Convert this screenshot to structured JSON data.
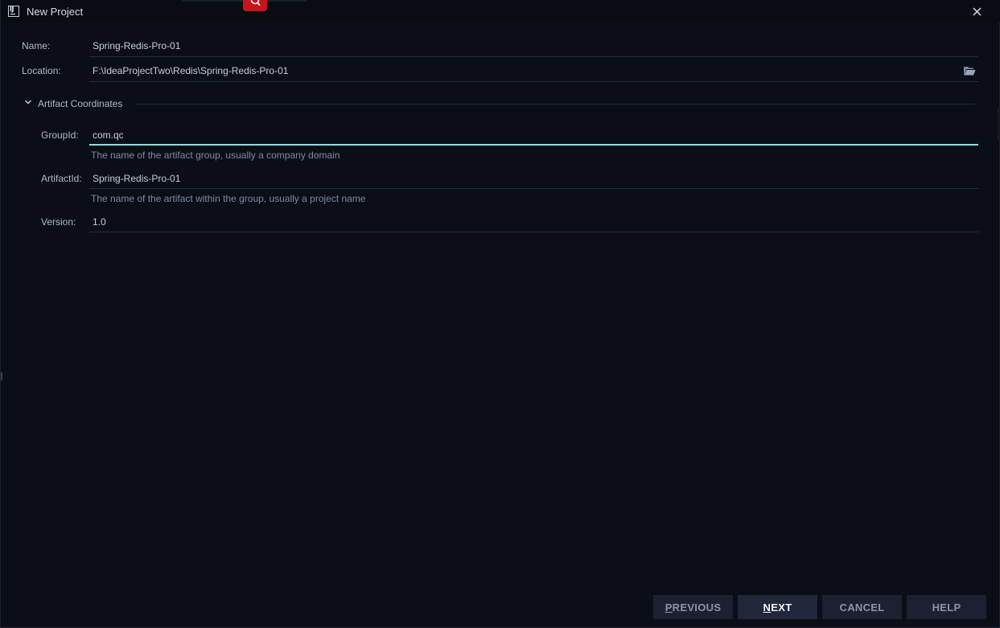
{
  "window": {
    "title": "New Project"
  },
  "form": {
    "name": {
      "label": "Name:",
      "value": "Spring-Redis-Pro-01"
    },
    "location": {
      "label": "Location:",
      "value": "F:\\IdeaProjectTwo\\Redis\\Spring-Redis-Pro-01"
    },
    "artifact_section": {
      "label": "Artifact Coordinates",
      "expanded": true
    },
    "group_id": {
      "label": "GroupId:",
      "value": "com.qc",
      "hint": "The name of the artifact group, usually a company domain"
    },
    "artifact_id": {
      "label": "ArtifactId:",
      "value": "Spring-Redis-Pro-01",
      "hint": "The name of the artifact within the group, usually a project name"
    },
    "version": {
      "label": "Version:",
      "value": "1.0"
    }
  },
  "buttons": {
    "previous": {
      "mnemonic": "P",
      "rest": "REVIOUS"
    },
    "next": {
      "mnemonic": "N",
      "rest": "EXT"
    },
    "cancel": "CANCEL",
    "help": "HELP"
  },
  "icons": {
    "app": "intellij-icon",
    "close": "close-icon",
    "folder": "folder-open-icon",
    "chevron": "chevron-down-icon",
    "search": "search-icon"
  },
  "colors": {
    "background": "#0b0e16",
    "focus_underline": "#7fe3e6",
    "hint_text": "#7e88a8",
    "primary_button": "#20273a",
    "badge_red": "#c4161c"
  }
}
